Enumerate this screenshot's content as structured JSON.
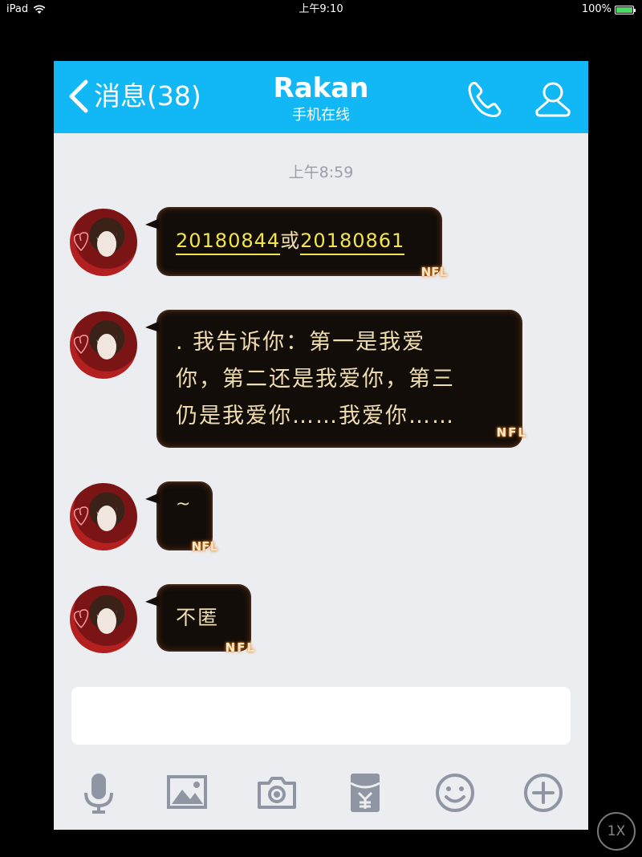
{
  "status_bar": {
    "device": "iPad",
    "time": "上午9:10",
    "battery": "100%",
    "battery_level": 1.0
  },
  "nav": {
    "back_label": "消息(38)",
    "title": "Rakan",
    "subtitle": "手机在线"
  },
  "chat": {
    "timestamp": "上午8:59",
    "messages": [
      {
        "num1": "20180844",
        "joiner": "或",
        "num2": "20180861",
        "sig": "NFL"
      },
      {
        "line1": ". 我告诉你：第一是我爱",
        "line2": "你，第二还是我爱你，第三",
        "line3": "仍是我爱你……我爱你……",
        "sig": "NFL"
      },
      {
        "text": "~",
        "sig": "NFL"
      },
      {
        "text": "不匿",
        "sig": "NFL"
      }
    ]
  },
  "toolbar": {
    "icons": [
      "microphone-icon",
      "image-icon",
      "camera-icon",
      "red-packet-icon",
      "emoji-icon",
      "plus-icon"
    ]
  },
  "zoom": "1X",
  "colors": {
    "nav_bg": "#12b7f5",
    "chat_bg": "#ebedf1",
    "bubble_bg": "#130d0a",
    "number_text": "#f3e548",
    "bubble_text": "#f0ddb0"
  }
}
